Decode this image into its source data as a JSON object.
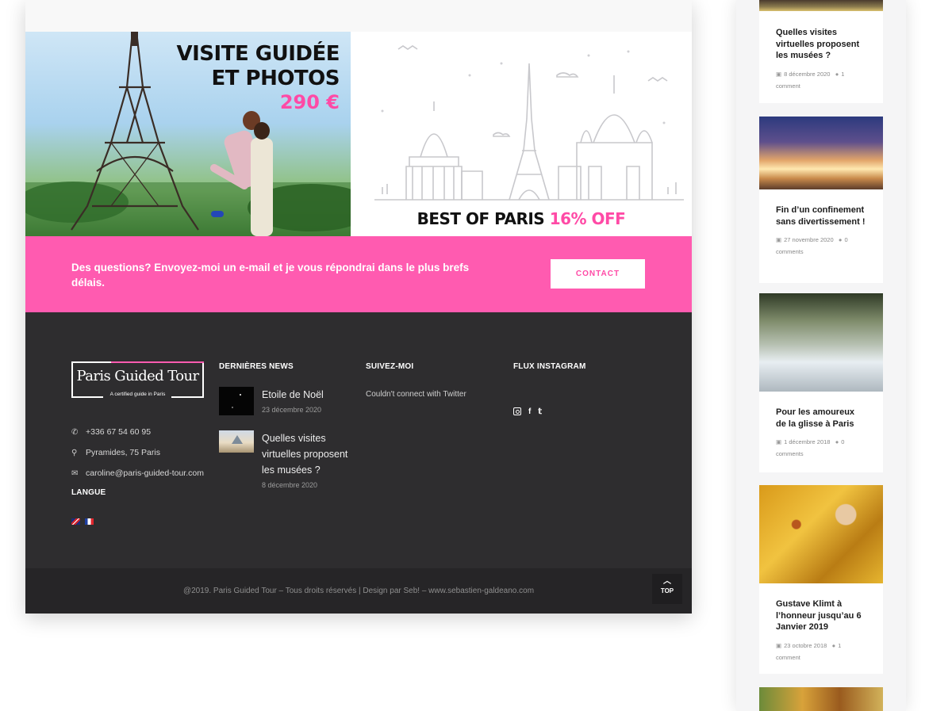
{
  "banner": {
    "title_line1": "VISITE GUIDÉE",
    "title_line2": "ET PHOTOS",
    "price": "290 €",
    "promo_main": "BEST OF PARIS ",
    "promo_off": "16% OFF"
  },
  "contact_band": {
    "text": "Des questions? Envoyez-moi un e-mail et je vous répondrai dans le plus brefs délais.",
    "button": "CONTACT"
  },
  "footer": {
    "logo_title": "Paris Guided Tour",
    "logo_subtitle": "A certified guide in Paris",
    "phone": "+336 67 54 60 95",
    "address": "Pyramides, 75 Paris",
    "email": "caroline@paris-guided-tour.com",
    "langue_title": "LANGUE",
    "news_title": "DERNIÈRES NEWS",
    "news": [
      {
        "title": "Etoile de Noël",
        "date": "23 décembre 2020"
      },
      {
        "title": "Quelles visites virtuelles proposent les musées ?",
        "date": "8 décembre 2020"
      }
    ],
    "suivez_title": "SUIVEZ-MOI",
    "twitter_error": "Couldn't connect with Twitter",
    "instagram_title": "FLUX INSTAGRAM",
    "copyright": "@2019. Paris Guided Tour – Tous droits réservés | Design par Seb! – www.sebastien-galdeano.com",
    "top_label": "TOP"
  },
  "blog": [
    {
      "title": "Quelles visites virtuelles proposent les musées ?",
      "date": "8 décembre 2020",
      "comments": "1 comment"
    },
    {
      "title": "Fin d’un confinement sans divertissement !",
      "date": "27 novembre 2020",
      "comments": "0 comments"
    },
    {
      "title": "Pour les amoureux de la glisse à Paris",
      "date": "1 décembre 2018",
      "comments": "0 comments"
    },
    {
      "title": "Gustave Klimt à l’honneur jusqu’au 6 Janvier 2019",
      "date": "23 octobre 2018",
      "comments": "1 comment"
    }
  ],
  "icons": {
    "phone": "phone-icon",
    "pin": "map-pin-icon",
    "mail": "envelope-icon",
    "calendar": "calendar-icon",
    "comment": "comment-icon",
    "instagram": "instagram-icon",
    "facebook": "facebook-icon",
    "twitter": "twitter-icon",
    "chevron_up": "chevron-up-icon"
  },
  "colors": {
    "accent_pink": "#ff5bb0",
    "footer_bg": "#2e2d2f",
    "bottom_bar_bg": "#262527"
  }
}
